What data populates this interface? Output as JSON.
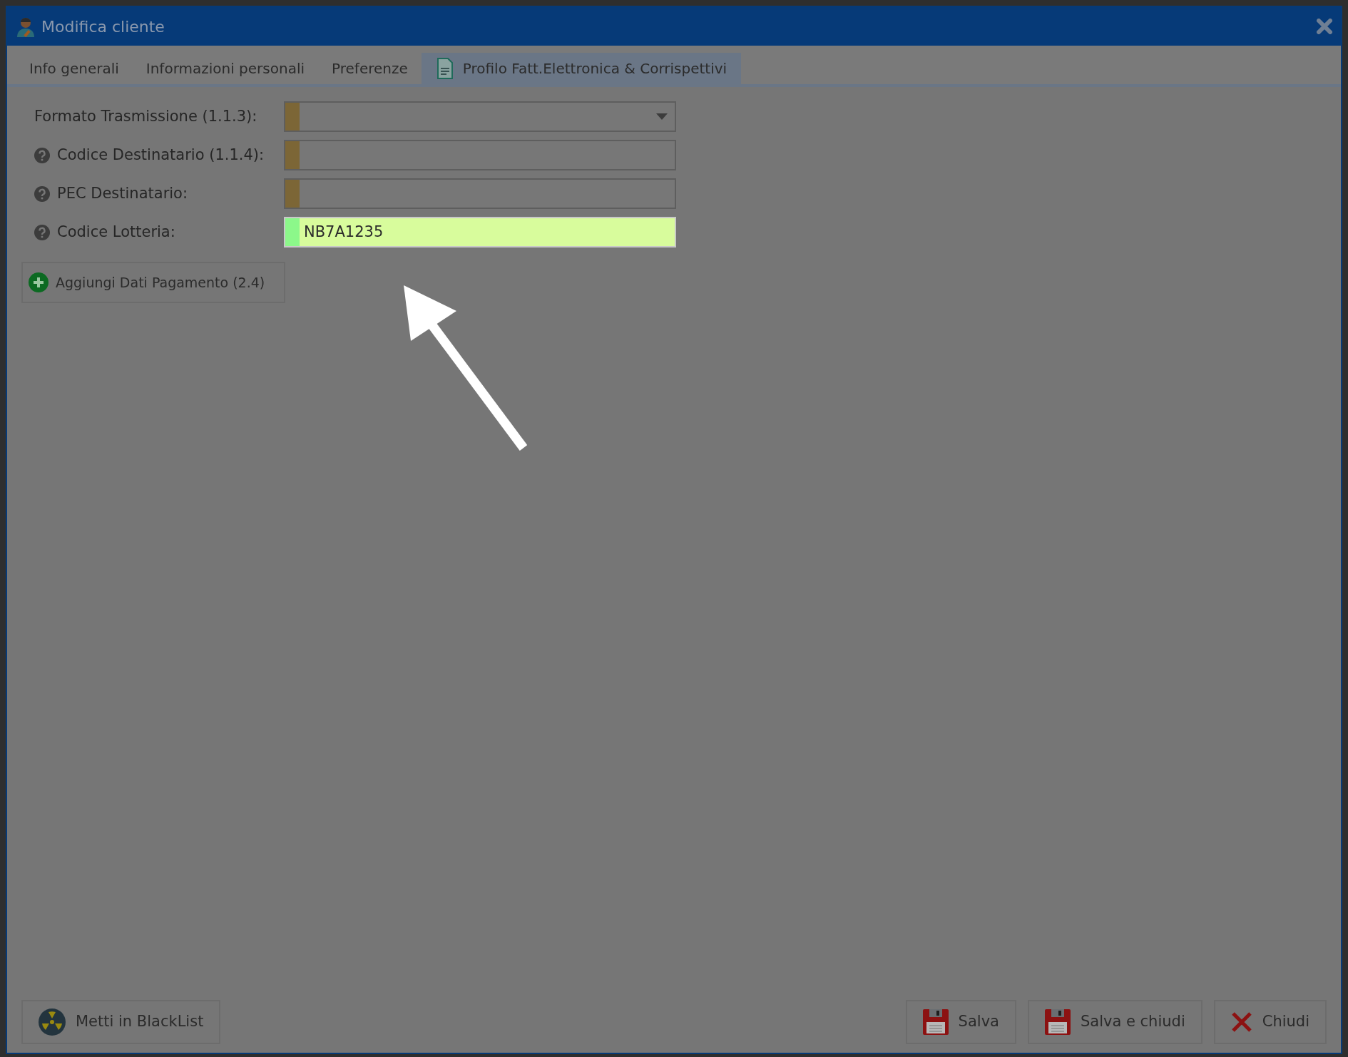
{
  "window": {
    "title": "Modifica cliente"
  },
  "tabs": [
    {
      "label": "Info generali",
      "selected": false,
      "kind": "plain"
    },
    {
      "label": "Informazioni personali",
      "selected": false,
      "kind": "plain"
    },
    {
      "label": "Preferenze",
      "selected": false,
      "kind": "plain"
    },
    {
      "label": "Profilo Fatt.Elettronica & Corrispettivi",
      "selected": true,
      "kind": "document"
    }
  ],
  "fields": [
    {
      "label": "Formato Trasmissione (1.1.3):",
      "kind": "dropdown",
      "help": false,
      "valid": false
    },
    {
      "label": "Codice Destinatario (1.1.4):",
      "kind": "text",
      "help": true,
      "valid": false
    },
    {
      "label": "PEC Destinatario:",
      "kind": "text",
      "help": true,
      "valid": false
    },
    {
      "label": "Codice Lotteria:",
      "kind": "text",
      "help": true,
      "valid": true,
      "value": "NB7A1235"
    }
  ],
  "add_button": {
    "label": "Aggiungi Dati Pagamento (2.4)"
  },
  "footer": {
    "left": [
      {
        "label": "Metti in BlackList",
        "kind": "blacklist"
      }
    ],
    "right": [
      {
        "label": "Salva",
        "kind": "save"
      },
      {
        "label": "Salva e chiudi",
        "kind": "save"
      },
      {
        "label": "Chiudi",
        "kind": "close"
      }
    ]
  }
}
